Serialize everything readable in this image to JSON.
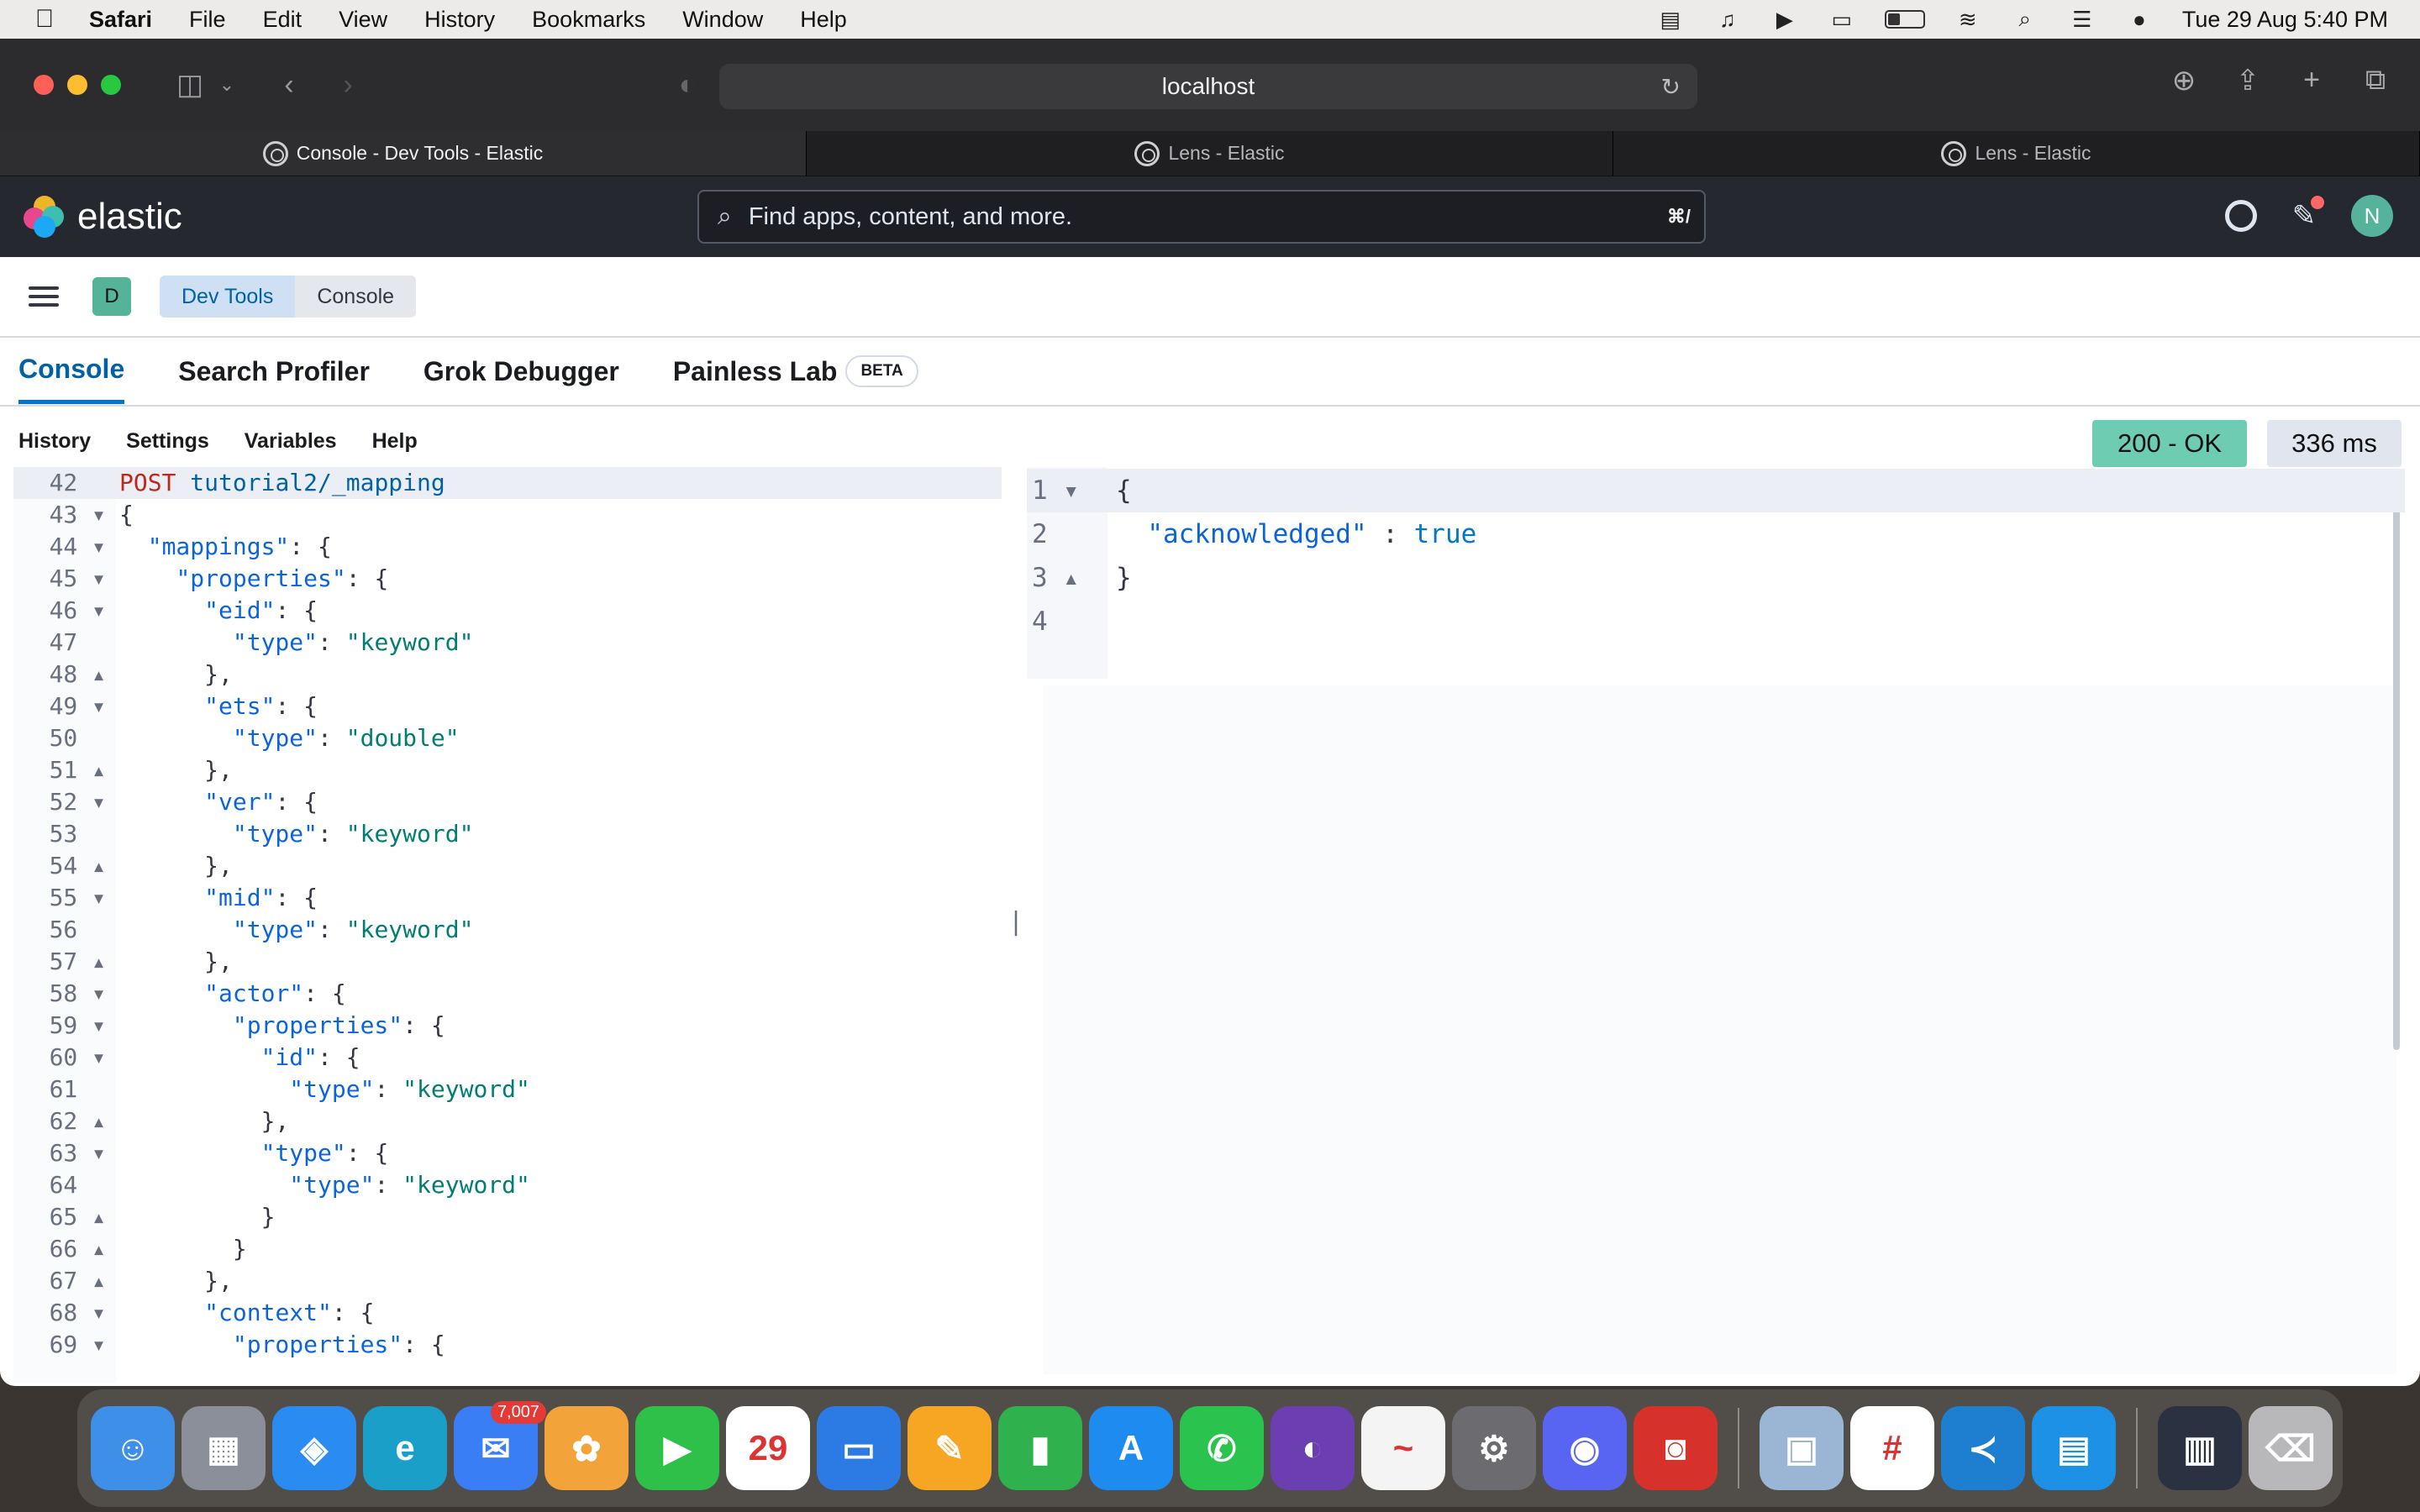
{
  "menubar": {
    "app": "Safari",
    "items": [
      "File",
      "Edit",
      "View",
      "History",
      "Bookmarks",
      "Window",
      "Help"
    ],
    "datetime": "Tue 29 Aug  5:40 PM"
  },
  "browser": {
    "url": "localhost",
    "tabs": [
      {
        "label": "Console - Dev Tools - Elastic",
        "active": true
      },
      {
        "label": "Lens - Elastic",
        "active": false
      },
      {
        "label": "Lens - Elastic",
        "active": false
      }
    ]
  },
  "kibana": {
    "logo_text": "elastic",
    "search_placeholder": "Find apps, content, and more.",
    "search_shortcut": "⌘/",
    "avatar_initial": "N",
    "space_initial": "D",
    "breadcrumbs": [
      "Dev Tools",
      "Console"
    ],
    "devtools_tabs": [
      "Console",
      "Search Profiler",
      "Grok Debugger",
      "Painless Lab"
    ],
    "beta_label": "BETA",
    "console_menu": [
      "History",
      "Settings",
      "Variables",
      "Help"
    ],
    "status": "200 - OK",
    "duration": "336 ms"
  },
  "request_editor": {
    "method": "POST",
    "path": "tutorial2/_mapping",
    "lines": [
      {
        "n": "42",
        "fold": "",
        "html": "REQ"
      },
      {
        "n": "43",
        "fold": "▾",
        "text": "{"
      },
      {
        "n": "44",
        "fold": "▾",
        "indent": 1,
        "key": "\"mappings\"",
        "rest": ": {"
      },
      {
        "n": "45",
        "fold": "▾",
        "indent": 2,
        "key": "\"properties\"",
        "rest": ": {"
      },
      {
        "n": "46",
        "fold": "▾",
        "indent": 3,
        "key": "\"eid\"",
        "rest": ": {"
      },
      {
        "n": "47",
        "fold": "",
        "indent": 4,
        "key": "\"type\"",
        "rest": ": ",
        "val": "\"keyword\""
      },
      {
        "n": "48",
        "fold": "▴",
        "indent": 3,
        "rest": "},"
      },
      {
        "n": "49",
        "fold": "▾",
        "indent": 3,
        "key": "\"ets\"",
        "rest": ": {"
      },
      {
        "n": "50",
        "fold": "",
        "indent": 4,
        "key": "\"type\"",
        "rest": ": ",
        "val": "\"double\""
      },
      {
        "n": "51",
        "fold": "▴",
        "indent": 3,
        "rest": "},"
      },
      {
        "n": "52",
        "fold": "▾",
        "indent": 3,
        "key": "\"ver\"",
        "rest": ": {"
      },
      {
        "n": "53",
        "fold": "",
        "indent": 4,
        "key": "\"type\"",
        "rest": ": ",
        "val": "\"keyword\""
      },
      {
        "n": "54",
        "fold": "▴",
        "indent": 3,
        "rest": "},"
      },
      {
        "n": "55",
        "fold": "▾",
        "indent": 3,
        "key": "\"mid\"",
        "rest": ": {"
      },
      {
        "n": "56",
        "fold": "",
        "indent": 4,
        "key": "\"type\"",
        "rest": ": ",
        "val": "\"keyword\""
      },
      {
        "n": "57",
        "fold": "▴",
        "indent": 3,
        "rest": "},"
      },
      {
        "n": "58",
        "fold": "▾",
        "indent": 3,
        "key": "\"actor\"",
        "rest": ": {"
      },
      {
        "n": "59",
        "fold": "▾",
        "indent": 4,
        "key": "\"properties\"",
        "rest": ": {"
      },
      {
        "n": "60",
        "fold": "▾",
        "indent": 5,
        "key": "\"id\"",
        "rest": ": {"
      },
      {
        "n": "61",
        "fold": "",
        "indent": 6,
        "key": "\"type\"",
        "rest": ": ",
        "val": "\"keyword\""
      },
      {
        "n": "62",
        "fold": "▴",
        "indent": 5,
        "rest": "},"
      },
      {
        "n": "63",
        "fold": "▾",
        "indent": 5,
        "key": "\"type\"",
        "rest": ": {"
      },
      {
        "n": "64",
        "fold": "",
        "indent": 6,
        "key": "\"type\"",
        "rest": ": ",
        "val": "\"keyword\""
      },
      {
        "n": "65",
        "fold": "▴",
        "indent": 5,
        "rest": "}"
      },
      {
        "n": "66",
        "fold": "▴",
        "indent": 4,
        "rest": "}"
      },
      {
        "n": "67",
        "fold": "▴",
        "indent": 3,
        "rest": "},"
      },
      {
        "n": "68",
        "fold": "▾",
        "indent": 3,
        "key": "\"context\"",
        "rest": ": {"
      },
      {
        "n": "69",
        "fold": "▾",
        "indent": 4,
        "key": "\"properties\"",
        "rest": ": {"
      }
    ]
  },
  "response_editor": {
    "lines": [
      {
        "n": "1",
        "fold": "▾",
        "text": "{"
      },
      {
        "n": "2",
        "fold": "",
        "key": "\"acknowledged\"",
        "sep": " : ",
        "bool": "true"
      },
      {
        "n": "3",
        "fold": "▴",
        "text": "}"
      },
      {
        "n": "4",
        "fold": "",
        "text": ""
      }
    ]
  },
  "dock": [
    {
      "name": "finder",
      "color": "#3d8fe8",
      "glyph": "☺"
    },
    {
      "name": "launchpad",
      "color": "#8a8f99",
      "glyph": "▦"
    },
    {
      "name": "safari",
      "color": "#2a8cf0",
      "glyph": "◈"
    },
    {
      "name": "edge",
      "color": "#1aa0c8",
      "glyph": "e"
    },
    {
      "name": "mail",
      "color": "#3a7ef6",
      "glyph": "✉",
      "badge": "7,007"
    },
    {
      "name": "photos",
      "color": "#f2a33a",
      "glyph": "✿"
    },
    {
      "name": "facetime",
      "color": "#2fc04a",
      "glyph": "▶"
    },
    {
      "name": "calendar",
      "color": "#ffffff",
      "glyph": "29"
    },
    {
      "name": "keynote",
      "color": "#2c7be5",
      "glyph": "▭"
    },
    {
      "name": "pages",
      "color": "#f6a623",
      "glyph": "✎"
    },
    {
      "name": "numbers",
      "color": "#2fb14e",
      "glyph": "▮"
    },
    {
      "name": "app-store",
      "color": "#1d8bf0",
      "glyph": "A"
    },
    {
      "name": "whatsapp",
      "color": "#29c34e",
      "glyph": "✆"
    },
    {
      "name": "github-desktop",
      "color": "#6b3fb0",
      "glyph": "◐"
    },
    {
      "name": "freeform",
      "color": "#f4f4f4",
      "glyph": "~"
    },
    {
      "name": "system-settings",
      "color": "#6c6c70",
      "glyph": "⚙"
    },
    {
      "name": "discord",
      "color": "#5865f2",
      "glyph": "◉"
    },
    {
      "name": "photo-booth",
      "color": "#d6312b",
      "glyph": "◙"
    },
    {
      "name": "preview",
      "color": "#9bb6d4",
      "glyph": "▣"
    },
    {
      "name": "slack",
      "color": "#ffffff",
      "glyph": "#"
    },
    {
      "name": "vscode",
      "color": "#1e7fd0",
      "glyph": "≺"
    },
    {
      "name": "docker",
      "color": "#1d91e6",
      "glyph": "▤"
    },
    {
      "name": "desktop-stack",
      "color": "#2a3140",
      "glyph": "▥"
    },
    {
      "name": "trash",
      "color": "#b8b8bb",
      "glyph": "⌫"
    }
  ]
}
